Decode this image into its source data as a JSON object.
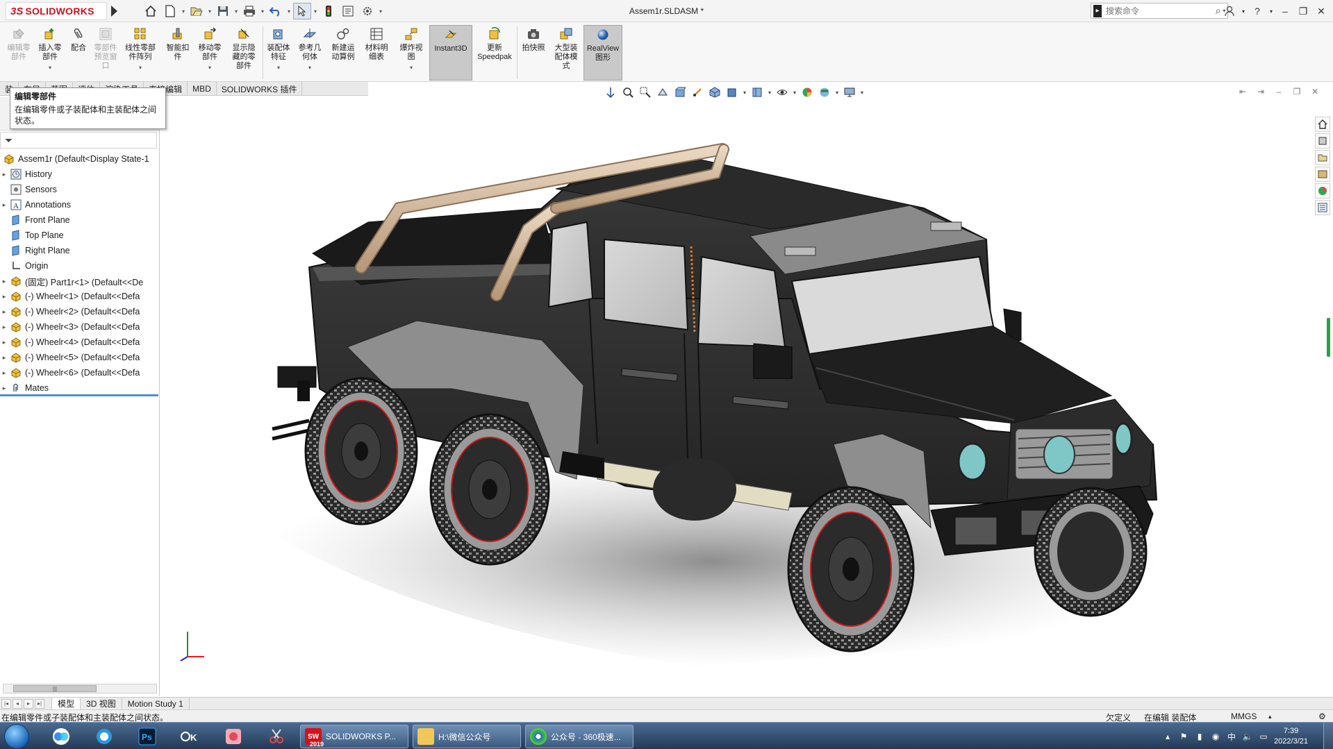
{
  "app": {
    "brand_ds": "3S",
    "brand_name": "SOLIDWORKS",
    "document_title": "Assem1r.SLDASM *",
    "search_placeholder": "搜索命令"
  },
  "ribbon": {
    "buttons": [
      {
        "label": "编辑零\n部件",
        "disabled": true
      },
      {
        "label": "插入零\n部件"
      },
      {
        "label": "配合"
      },
      {
        "label": "零部件\n预览窗\n口",
        "disabled": true
      },
      {
        "label": "线性零部\n件阵列"
      },
      {
        "label": "智能扣\n件"
      },
      {
        "label": "移动零\n部件"
      },
      {
        "label": "显示隐\n藏的零\n部件"
      },
      {
        "label": "装配体\n特征"
      },
      {
        "label": "参考几\n何体"
      },
      {
        "label": "新建运\n动算例"
      },
      {
        "label": "材料明\n细表"
      },
      {
        "label": "爆炸视\n图"
      },
      {
        "label": "Instant3D",
        "active": true
      },
      {
        "label": "更新\nSpeedpak"
      },
      {
        "label": "拍快照"
      },
      {
        "label": "大型装\n配体模\n式"
      },
      {
        "label": "RealView\n图形",
        "active": true
      }
    ]
  },
  "command_tabs": [
    "装",
    "布局",
    "草图",
    "评估",
    "渲染工具",
    "直接编辑",
    "MBD",
    "SOLIDWORKS 插件"
  ],
  "tooltip": {
    "title": "编辑零部件",
    "body": "在编辑零件或子装配体和主装配体之间状态。"
  },
  "feature_tree": {
    "root": "Assem1r  (Default<Display State-1",
    "items": [
      {
        "label": "History",
        "icon": "history-icon",
        "expandable": true
      },
      {
        "label": "Sensors",
        "icon": "sensors-icon",
        "expandable": false
      },
      {
        "label": "Annotations",
        "icon": "annotations-icon",
        "expandable": true
      },
      {
        "label": "Front Plane",
        "icon": "plane-icon",
        "expandable": false
      },
      {
        "label": "Top Plane",
        "icon": "plane-icon",
        "expandable": false
      },
      {
        "label": "Right Plane",
        "icon": "plane-icon",
        "expandable": false
      },
      {
        "label": "Origin",
        "icon": "origin-icon",
        "expandable": false
      },
      {
        "label": "(固定) Part1r<1> (Default<<De",
        "icon": "part-icon",
        "expandable": true
      },
      {
        "label": "(-) Wheelr<1> (Default<<Defa",
        "icon": "part-icon",
        "expandable": true
      },
      {
        "label": "(-) Wheelr<2> (Default<<Defa",
        "icon": "part-icon",
        "expandable": true
      },
      {
        "label": "(-) Wheelr<3> (Default<<Defa",
        "icon": "part-icon",
        "expandable": true
      },
      {
        "label": "(-) Wheelr<4> (Default<<Defa",
        "icon": "part-icon",
        "expandable": true
      },
      {
        "label": "(-) Wheelr<5> (Default<<Defa",
        "icon": "part-icon",
        "expandable": true
      },
      {
        "label": "(-) Wheelr<6> (Default<<Defa",
        "icon": "part-icon",
        "expandable": true
      },
      {
        "label": "Mates",
        "icon": "mates-icon",
        "expandable": true
      }
    ]
  },
  "bottom_tabs": [
    "模型",
    "3D 视图",
    "Motion Study 1"
  ],
  "status": {
    "message": "在编辑零件或子装配体和主装配体之间状态。",
    "definition": "欠定义",
    "editing": "在编辑 装配体",
    "units": "MMGS"
  },
  "taskbar": {
    "items": [
      "SOLIDWORKS P...",
      "H:\\微信公众号",
      "公众号 - 360极速..."
    ],
    "badge_2019": "2019",
    "time": "7:39",
    "date": "2022/3/21"
  },
  "colors": {
    "brand_red": "#d1121c",
    "body_black": "#2b2b2b",
    "rollbar": "#d9c2a8",
    "rim_red": "#c81919",
    "headlight": "#7fc7c7",
    "tree_selection": "#4a90d9"
  }
}
